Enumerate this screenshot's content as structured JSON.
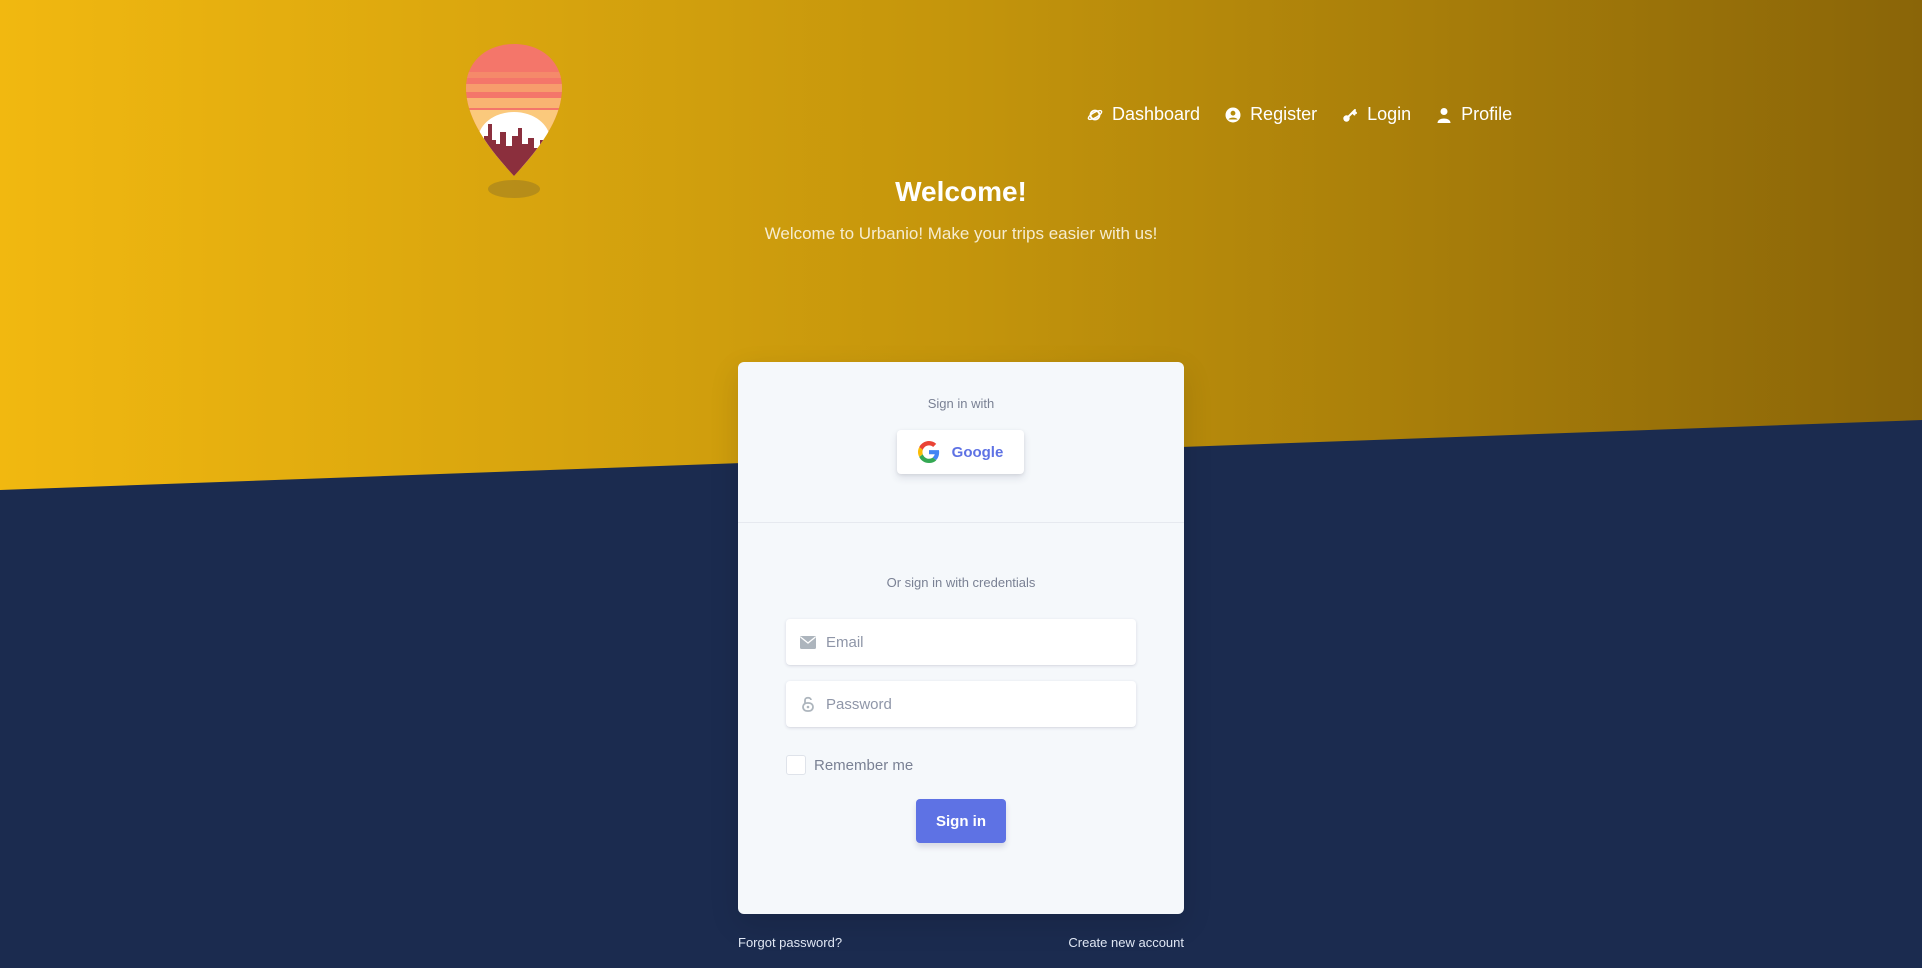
{
  "colors": {
    "hero_gradient_start": "#f1b810",
    "hero_gradient_end": "#8a6508",
    "background_navy": "#1b2b4f",
    "accent": "#5e72e4"
  },
  "nav": {
    "items": [
      {
        "label": "Dashboard",
        "icon": "planet-icon"
      },
      {
        "label": "Register",
        "icon": "user-circle-icon"
      },
      {
        "label": "Login",
        "icon": "key-icon"
      },
      {
        "label": "Profile",
        "icon": "user-icon"
      }
    ]
  },
  "header": {
    "title": "Welcome!",
    "subtitle": "Welcome to Urbanio! Make your trips easier with us!"
  },
  "login_card": {
    "sign_in_with_label": "Sign in with",
    "google_button_label": "Google",
    "credentials_label": "Or sign in with credentials",
    "email_placeholder": "Email",
    "password_placeholder": "Password",
    "remember_label": "Remember me",
    "sign_in_button_label": "Sign in"
  },
  "footer": {
    "forgot_password": "Forgot password?",
    "create_account": "Create new account"
  }
}
